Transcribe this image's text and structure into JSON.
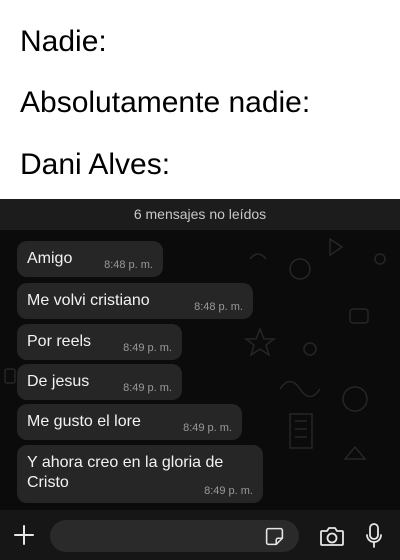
{
  "meme_captions": [
    "Nadie:",
    "Absolutamente nadie:",
    "Dani Alves:"
  ],
  "chat": {
    "unread_banner": "6 mensajes no leídos",
    "messages": [
      {
        "text": "Amigo",
        "time": "8:48 p. m."
      },
      {
        "text": "Me volvi cristiano",
        "time": "8:48 p. m."
      },
      {
        "text": "Por reels",
        "time": "8:49 p. m."
      },
      {
        "text": "De jesus",
        "time": "8:49 p. m."
      },
      {
        "text": "Me gusto el lore",
        "time": "8:49 p. m."
      },
      {
        "text": "Y ahora creo en la gloria de Cristo",
        "time": "8:49 p. m."
      }
    ]
  },
  "composer": {
    "input_value": "",
    "icons": [
      "plus-icon",
      "sticker-icon",
      "camera-icon",
      "microphone-icon"
    ]
  },
  "colors": {
    "chat_background": "#0b0b0b",
    "bubble": "#262626",
    "composer_bar": "#161616"
  }
}
